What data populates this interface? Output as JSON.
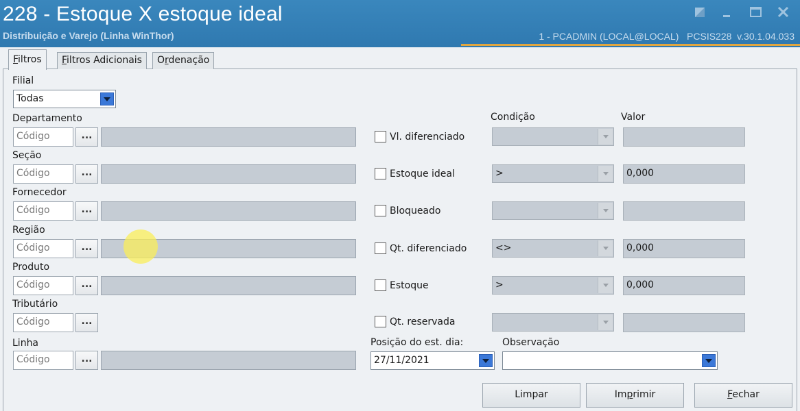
{
  "window": {
    "title": "228 - Estoque X estoque ideal",
    "subtitle": "Distribuição e Varejo (Linha WinThor)",
    "info": "1 - PCADMIN (LOCAL@LOCAL)   PCSIS228  v.30.1.04.033",
    "accent_color": "#e0a640",
    "controls": [
      "settings-icon",
      "minimize-icon",
      "maximize-icon",
      "close-icon"
    ]
  },
  "tabs": [
    {
      "pre": "",
      "u": "F",
      "post": "iltros"
    },
    {
      "pre": "",
      "u": "F",
      "post": "iltros Adicionais"
    },
    {
      "pre": "O",
      "u": "r",
      "post": "denação"
    }
  ],
  "filial": {
    "label": "Filial",
    "value": "Todas"
  },
  "code_placeholder": "Código",
  "lookup_btn": "...",
  "fields": {
    "departamento": "Departamento",
    "secao": "Seção",
    "fornecedor": "Fornecedor",
    "regiao": "Região",
    "produto": "Produto",
    "tributario": "Tributário",
    "linha": "Linha"
  },
  "conditions_header": {
    "condicao": "Condição",
    "valor": "Valor"
  },
  "conditions": [
    {
      "label": "Vl. diferenciado",
      "condition": "",
      "value": ""
    },
    {
      "label": "Estoque ideal",
      "condition": ">",
      "value": "0,000"
    },
    {
      "label": "Bloqueado",
      "condition": "",
      "value": ""
    },
    {
      "label": "Qt. diferenciado",
      "condition": "<>",
      "value": "0,000"
    },
    {
      "label": "Estoque",
      "condition": ">",
      "value": "0,000"
    },
    {
      "label": "Qt. reservada",
      "condition": "",
      "value": ""
    }
  ],
  "posicao": {
    "label": "Posição do est. dia:",
    "value": "27/11/2021"
  },
  "observacao": {
    "label": "Observação",
    "value": ""
  },
  "buttons": {
    "limpar": "Limpar",
    "imprimir": {
      "pre": "Im",
      "u": "p",
      "post": "rimir"
    },
    "fechar": {
      "pre": "",
      "u": "F",
      "post": "echar"
    }
  }
}
